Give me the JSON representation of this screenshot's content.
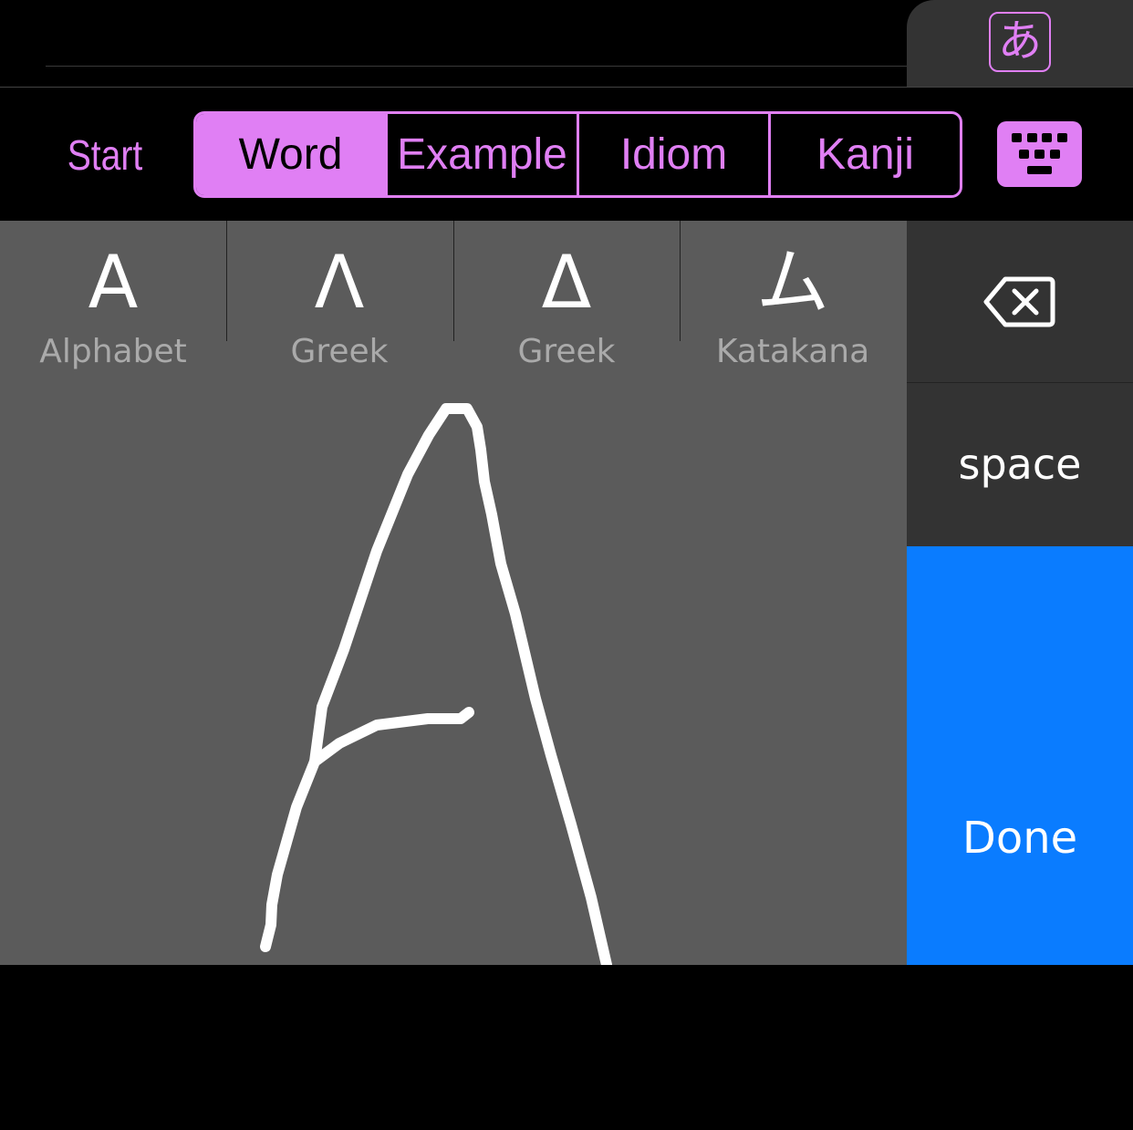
{
  "input_mode": {
    "icon": "hiragana-a-icon",
    "label": "あ"
  },
  "toolbar": {
    "start": "Start",
    "tabs": [
      {
        "label": "Word",
        "active": true
      },
      {
        "label": "Example",
        "active": false
      },
      {
        "label": "Idiom",
        "active": false
      },
      {
        "label": "Kanji",
        "active": false
      }
    ],
    "keyboard_icon": "keyboard-icon"
  },
  "candidates": [
    {
      "glyph": "A",
      "label": "Alphabet"
    },
    {
      "glyph": "Λ",
      "label": "Greek"
    },
    {
      "glyph": "Δ",
      "label": "Greek"
    },
    {
      "glyph": "ム",
      "label": "Katakana"
    }
  ],
  "keys": {
    "backspace_icon": "backspace-icon",
    "space": "space",
    "done": "Done"
  },
  "colors": {
    "accent": "#e07ff4",
    "done": "#0a7cff"
  }
}
